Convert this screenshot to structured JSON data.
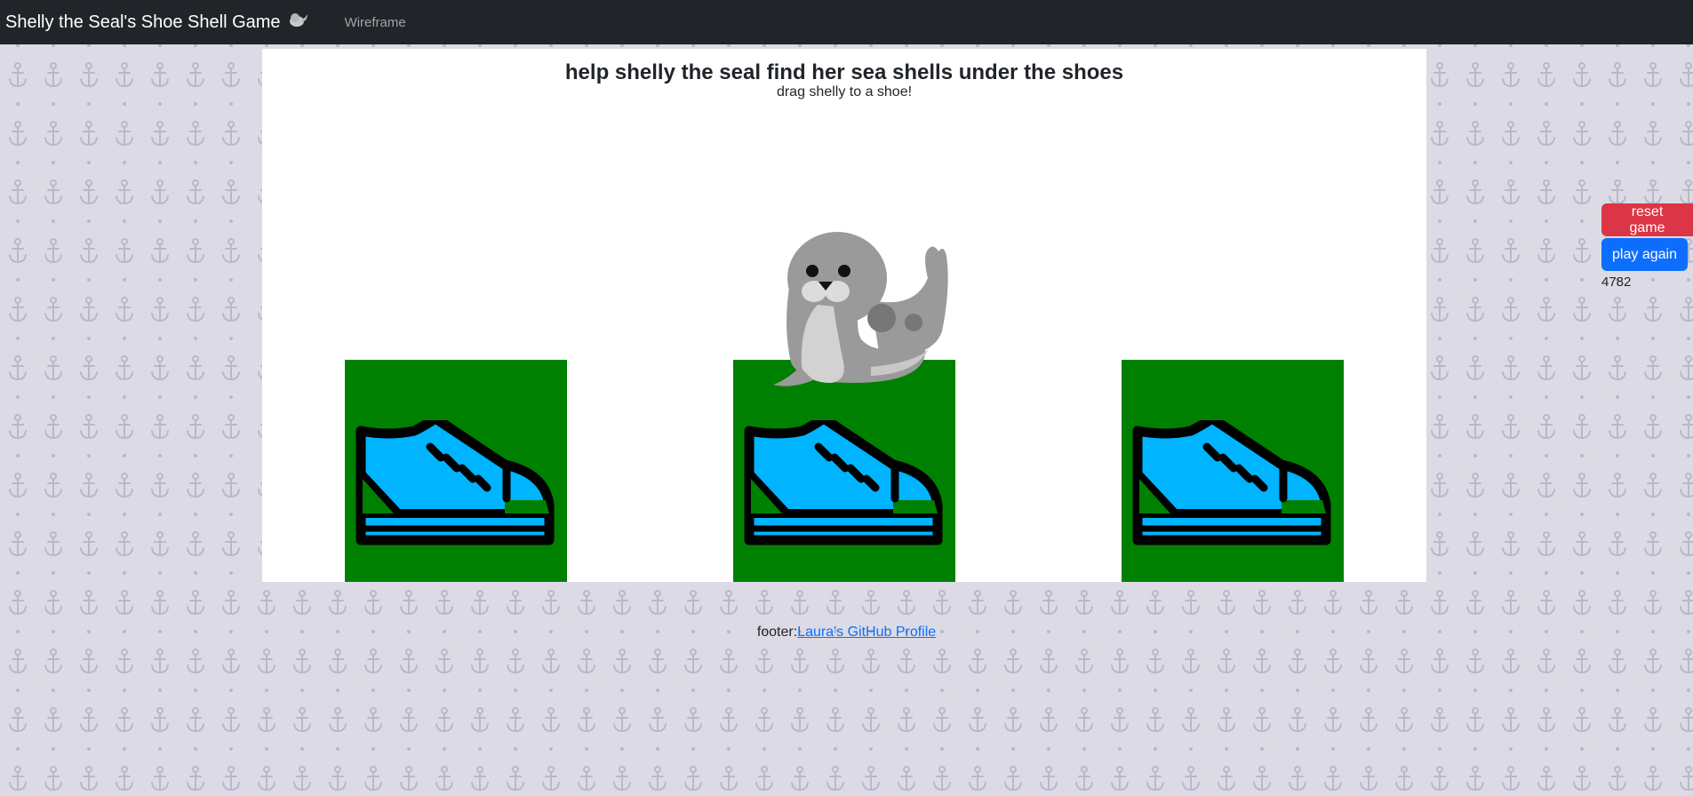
{
  "nav": {
    "brand": "Shelly the Seal's Shoe Shell Game",
    "links": [
      "Wireframe"
    ]
  },
  "game": {
    "title": "help shelly the seal find her sea shells under the shoes",
    "instruction": "drag shelly to a shoe!"
  },
  "controls": {
    "reset_label": "reset game",
    "play_again_label": "play again",
    "counter": "4782"
  },
  "footer": {
    "prefix": "footer:",
    "link_text": "Laura's GitHub Profile"
  },
  "colors": {
    "navbar": "#212529",
    "shoe_box": "#008000",
    "shoe": "#00b4ff",
    "reset_button": "#dc3545",
    "play_button": "#0d6efd"
  },
  "icons": [
    "seal-icon",
    "sneaker-icon",
    "anchor-icon"
  ]
}
